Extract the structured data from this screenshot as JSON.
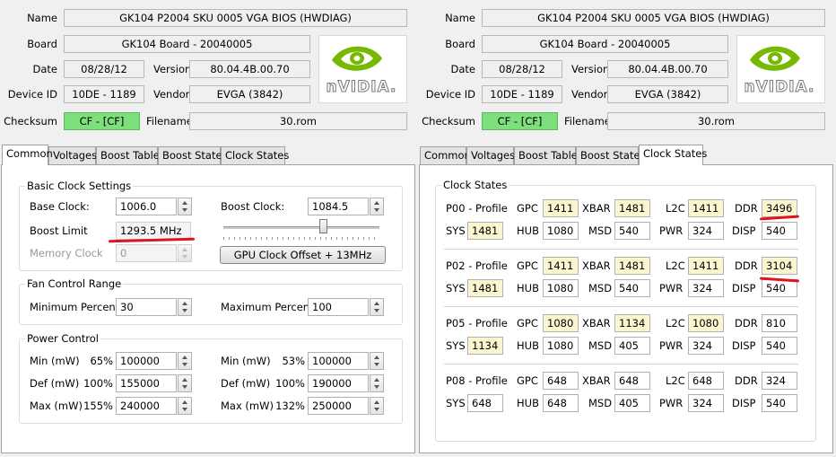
{
  "left": {
    "info": {
      "name_label": "Name",
      "name": "GK104 P2004 SKU 0005 VGA BIOS (HWDIAG)",
      "board_label": "Board",
      "board": "GK104 Board - 20040005",
      "date_label": "Date",
      "date": "08/28/12",
      "version_label": "Version",
      "version": "80.04.4B.00.70",
      "device_label": "Device ID",
      "device": "10DE - 1189",
      "vendor_label": "Vendor",
      "vendor": "EVGA (3842)",
      "checksum_label": "Checksum",
      "checksum": "CF - [CF]",
      "filename_label": "Filename",
      "filename": "30.rom"
    },
    "logo_text": "nVIDIA.",
    "tabs": [
      {
        "label": "Common",
        "active": true
      },
      {
        "label": "Voltages"
      },
      {
        "label": "Boost Table"
      },
      {
        "label": "Boost States"
      },
      {
        "label": "Clock States"
      }
    ],
    "basic": {
      "title": "Basic Clock Settings",
      "base_clock_label": "Base Clock:",
      "base_clock": "1006.0",
      "boost_clock_label": "Boost Clock:",
      "boost_clock": "1084.5",
      "boost_limit_label": "Boost Limit",
      "boost_limit": "1293.5 MHz",
      "memory_clock_label": "Memory Clock",
      "memory_clock": "0",
      "offset_button": "GPU Clock Offset + 13MHz"
    },
    "fan": {
      "title": "Fan Control Range",
      "min_label": "Minimum Percent:",
      "min": "30",
      "max_label": "Maximum Percent:",
      "max": "100"
    },
    "power": {
      "title": "Power Control",
      "rows": [
        {
          "label": "Min (mW)",
          "pct1": "65%",
          "val1": "100000",
          "label2": "Min (mW)",
          "pct2": "53%",
          "val2": "100000"
        },
        {
          "label": "Def (mW)",
          "pct1": "100%",
          "val1": "155000",
          "label2": "Def (mW)",
          "pct2": "100%",
          "val2": "190000"
        },
        {
          "label": "Max (mW)",
          "pct1": "155%",
          "val1": "240000",
          "label2": "Max (mW)",
          "pct2": "132%",
          "val2": "250000"
        }
      ]
    }
  },
  "right": {
    "info": {
      "name_label": "Name",
      "name": "GK104 P2004 SKU 0005 VGA BIOS (HWDIAG)",
      "board_label": "Board",
      "board": "GK104 Board - 20040005",
      "date_label": "Date",
      "date": "08/28/12",
      "version_label": "Version",
      "version": "80.04.4B.00.70",
      "device_label": "Device ID",
      "device": "10DE - 1189",
      "vendor_label": "Vendor",
      "vendor": "EVGA (3842)",
      "checksum_label": "Checksum",
      "checksum": "CF - [CF]",
      "filename_label": "Filename",
      "filename": "30.rom"
    },
    "logo_text": "nVIDIA.",
    "tabs": [
      {
        "label": "Common"
      },
      {
        "label": "Voltages"
      },
      {
        "label": "Boost Table"
      },
      {
        "label": "Boost States"
      },
      {
        "label": "Clock States",
        "active": true
      }
    ],
    "clock_states": {
      "title": "Clock States",
      "profiles": [
        {
          "name": "P00 - Profile",
          "gpc": "1411",
          "xbar": "1481",
          "l2c": "1411",
          "ddr": "3496",
          "sys": "1481",
          "hub": "1080",
          "msd": "540",
          "pwr": "324",
          "disp": "540"
        },
        {
          "name": "P02 - Profile",
          "gpc": "1411",
          "xbar": "1481",
          "l2c": "1411",
          "ddr": "3104",
          "sys": "1481",
          "hub": "1080",
          "msd": "540",
          "pwr": "324",
          "disp": "540"
        },
        {
          "name": "P05 - Profile",
          "gpc": "1080",
          "xbar": "1134",
          "l2c": "1080",
          "ddr": "810",
          "sys": "1134",
          "hub": "1080",
          "msd": "405",
          "pwr": "324",
          "disp": "540"
        },
        {
          "name": "P08 - Profile",
          "gpc": "648",
          "xbar": "648",
          "l2c": "648",
          "ddr": "324",
          "sys": "648",
          "hub": "648",
          "msd": "405",
          "pwr": "324",
          "disp": "540"
        }
      ],
      "labels": {
        "gpc": "GPC",
        "xbar": "XBAR",
        "l2c": "L2C",
        "ddr": "DDR",
        "sys": "SYS",
        "hub": "HUB",
        "msd": "MSD",
        "pwr": "PWR",
        "disp": "DISP"
      }
    }
  },
  "colors": {
    "checksum_green": "#7de07d",
    "annotation_red": "#e0141e",
    "highlight_yellow": "#fbf6cf",
    "nvidia_green": "#76b900"
  }
}
